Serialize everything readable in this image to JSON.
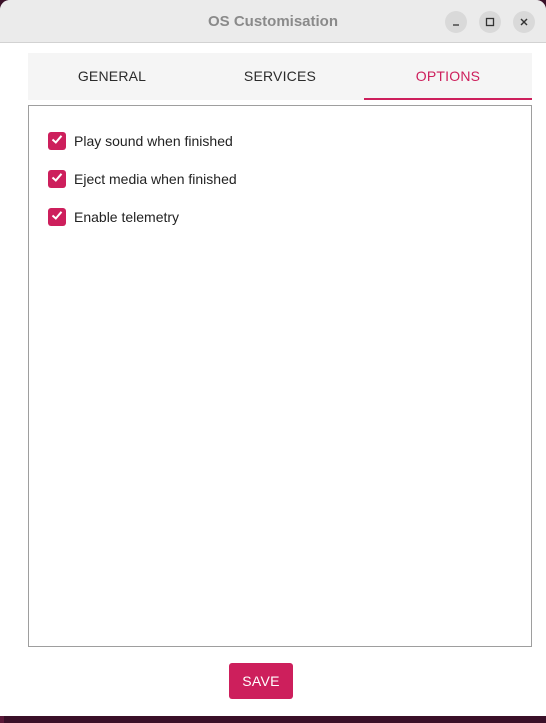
{
  "window": {
    "title": "OS Customisation",
    "controls": {
      "minimize": "minimize-icon",
      "maximize": "maximize-icon",
      "close": "close-icon"
    }
  },
  "tabs": [
    {
      "label": "GENERAL",
      "active": false
    },
    {
      "label": "SERVICES",
      "active": false
    },
    {
      "label": "OPTIONS",
      "active": true
    }
  ],
  "options": [
    {
      "label": "Play sound when finished",
      "checked": true
    },
    {
      "label": "Eject media when finished",
      "checked": true
    },
    {
      "label": "Enable telemetry",
      "checked": true
    }
  ],
  "footer": {
    "save_label": "SAVE"
  },
  "colors": {
    "accent": "#cd1f5c",
    "desktop": "#3a1028"
  }
}
